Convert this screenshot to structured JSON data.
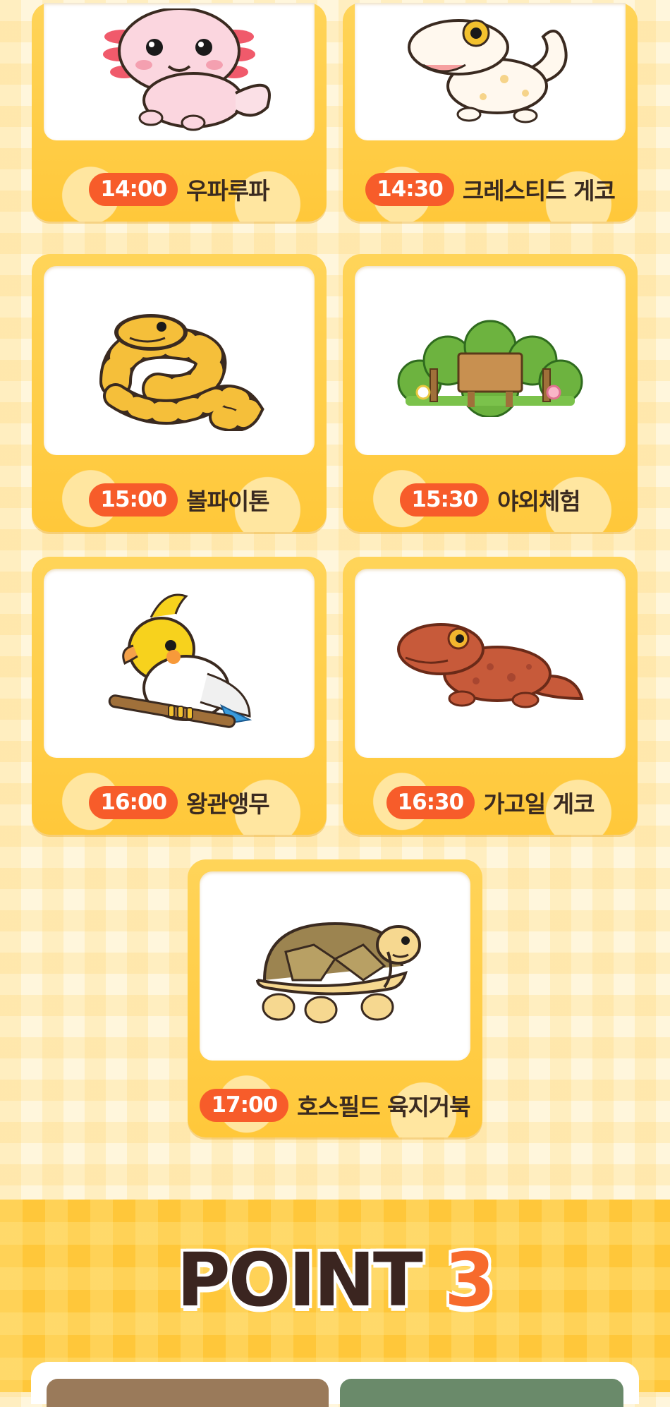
{
  "schedule": [
    {
      "time": "14:00",
      "name": "우파루파",
      "icon": "axolotl-icon"
    },
    {
      "time": "14:30",
      "name": "크레스티드 게코",
      "icon": "crested-gecko-icon"
    },
    {
      "time": "15:00",
      "name": "볼파이톤",
      "icon": "ball-python-icon"
    },
    {
      "time": "15:30",
      "name": "야외체험",
      "icon": "outdoor-sign-icon"
    },
    {
      "time": "16:00",
      "name": "왕관앵무",
      "icon": "cockatiel-icon"
    },
    {
      "time": "16:30",
      "name": "가고일 게코",
      "icon": "gargoyle-gecko-icon"
    },
    {
      "time": "17:00",
      "name": "호스필드 육지거북",
      "icon": "tortoise-icon"
    }
  ],
  "point": {
    "word": "POINT",
    "number": "3"
  },
  "colors": {
    "pill": "#f75c2a",
    "card": "#ffc83a",
    "band": "#ffc73a",
    "title_dark": "#3b2520",
    "title_accent": "#f76a2c"
  }
}
